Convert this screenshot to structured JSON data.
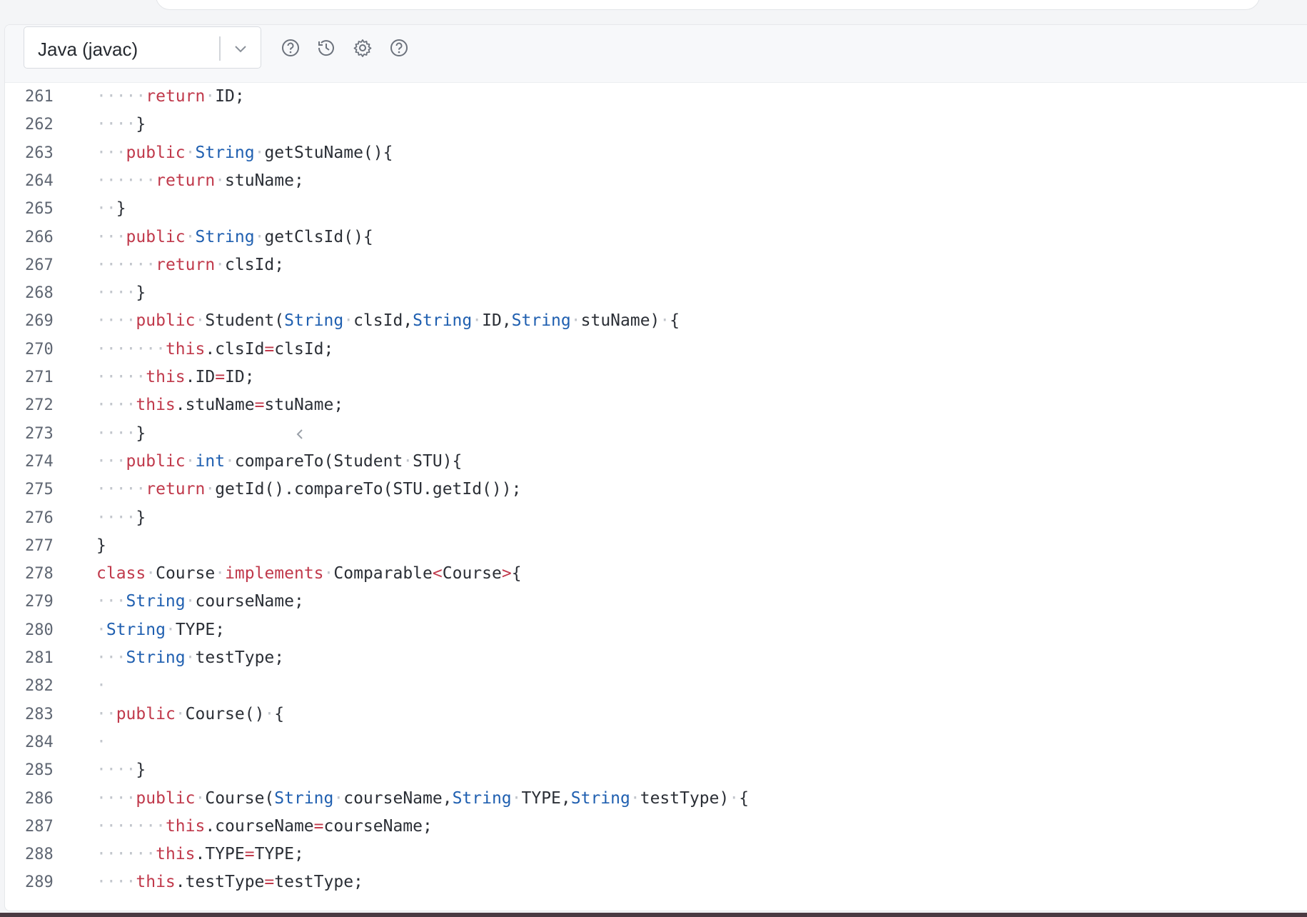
{
  "toolbar": {
    "language": "Java (javac)",
    "icons": [
      "help-circle-icon",
      "history-icon",
      "gear-icon",
      "help-circle-icon"
    ]
  },
  "colors": {
    "keyword": "#c0394b",
    "type": "#1f5fb0",
    "whitespace_dot": "#c2c6cc",
    "line_number": "#5f6672"
  },
  "editor": {
    "lines": [
      {
        "n": "261",
        "tokens": [
          [
            "ws",
            "·····"
          ],
          [
            "kw",
            "return"
          ],
          [
            "ws",
            "·"
          ],
          [
            "tx",
            "ID;"
          ]
        ]
      },
      {
        "n": "262",
        "tokens": [
          [
            "ws",
            "····"
          ],
          [
            "tx",
            "}"
          ]
        ]
      },
      {
        "n": "263",
        "tokens": [
          [
            "ws",
            "···"
          ],
          [
            "kw",
            "public"
          ],
          [
            "ws",
            "·"
          ],
          [
            "ty",
            "String"
          ],
          [
            "ws",
            "·"
          ],
          [
            "tx",
            "getStuName(){"
          ]
        ]
      },
      {
        "n": "264",
        "tokens": [
          [
            "ws",
            "······"
          ],
          [
            "kw",
            "return"
          ],
          [
            "ws",
            "·"
          ],
          [
            "tx",
            "stuName;"
          ]
        ]
      },
      {
        "n": "265",
        "tokens": [
          [
            "ws",
            "··"
          ],
          [
            "tx",
            "}"
          ]
        ]
      },
      {
        "n": "266",
        "tokens": [
          [
            "ws",
            "···"
          ],
          [
            "kw",
            "public"
          ],
          [
            "ws",
            "·"
          ],
          [
            "ty",
            "String"
          ],
          [
            "ws",
            "·"
          ],
          [
            "tx",
            "getClsId(){"
          ]
        ]
      },
      {
        "n": "267",
        "tokens": [
          [
            "ws",
            "······"
          ],
          [
            "kw",
            "return"
          ],
          [
            "ws",
            "·"
          ],
          [
            "tx",
            "clsId;"
          ]
        ]
      },
      {
        "n": "268",
        "tokens": [
          [
            "ws",
            "····"
          ],
          [
            "tx",
            "}"
          ]
        ]
      },
      {
        "n": "269",
        "tokens": [
          [
            "ws",
            "····"
          ],
          [
            "kw",
            "public"
          ],
          [
            "ws",
            "·"
          ],
          [
            "tx",
            "Student("
          ],
          [
            "ty",
            "String"
          ],
          [
            "ws",
            "·"
          ],
          [
            "tx",
            "clsId,"
          ],
          [
            "ty",
            "String"
          ],
          [
            "ws",
            "·"
          ],
          [
            "tx",
            "ID,"
          ],
          [
            "ty",
            "String"
          ],
          [
            "ws",
            "·"
          ],
          [
            "tx",
            "stuName)"
          ],
          [
            "ws",
            "·"
          ],
          [
            "tx",
            "{"
          ]
        ]
      },
      {
        "n": "270",
        "tokens": [
          [
            "ws",
            "·······"
          ],
          [
            "kw",
            "this"
          ],
          [
            "tx",
            ".clsId"
          ],
          [
            "op",
            "="
          ],
          [
            "tx",
            "clsId;"
          ]
        ]
      },
      {
        "n": "271",
        "tokens": [
          [
            "ws",
            "·····"
          ],
          [
            "kw",
            "this"
          ],
          [
            "tx",
            ".ID"
          ],
          [
            "op",
            "="
          ],
          [
            "tx",
            "ID;"
          ]
        ]
      },
      {
        "n": "272",
        "tokens": [
          [
            "ws",
            "····"
          ],
          [
            "kw",
            "this"
          ],
          [
            "tx",
            ".stuName"
          ],
          [
            "op",
            "="
          ],
          [
            "tx",
            "stuName;"
          ]
        ]
      },
      {
        "n": "273",
        "tokens": [
          [
            "ws",
            "····"
          ],
          [
            "tx",
            "}"
          ]
        ]
      },
      {
        "n": "274",
        "tokens": [
          [
            "ws",
            "···"
          ],
          [
            "kw",
            "public"
          ],
          [
            "ws",
            "·"
          ],
          [
            "ty",
            "int"
          ],
          [
            "ws",
            "·"
          ],
          [
            "tx",
            "compareTo(Student"
          ],
          [
            "ws",
            "·"
          ],
          [
            "tx",
            "STU){"
          ]
        ]
      },
      {
        "n": "275",
        "tokens": [
          [
            "ws",
            "·····"
          ],
          [
            "kw",
            "return"
          ],
          [
            "ws",
            "·"
          ],
          [
            "tx",
            "getId().compareTo(STU.getId());"
          ]
        ]
      },
      {
        "n": "276",
        "tokens": [
          [
            "ws",
            "····"
          ],
          [
            "tx",
            "}"
          ]
        ]
      },
      {
        "n": "277",
        "tokens": [
          [
            "tx",
            "}"
          ]
        ]
      },
      {
        "n": "278",
        "tokens": [
          [
            "kw",
            "class"
          ],
          [
            "ws",
            "·"
          ],
          [
            "tx",
            "Course"
          ],
          [
            "ws",
            "·"
          ],
          [
            "kw",
            "implements"
          ],
          [
            "ws",
            "·"
          ],
          [
            "tx",
            "Comparable"
          ],
          [
            "op",
            "<"
          ],
          [
            "tx",
            "Course"
          ],
          [
            "op",
            ">"
          ],
          [
            "tx",
            "{"
          ]
        ]
      },
      {
        "n": "279",
        "tokens": [
          [
            "ws",
            "···"
          ],
          [
            "ty",
            "String"
          ],
          [
            "ws",
            "·"
          ],
          [
            "tx",
            "courseName;"
          ]
        ]
      },
      {
        "n": "280",
        "tokens": [
          [
            "ws",
            "·"
          ],
          [
            "ty",
            "String"
          ],
          [
            "ws",
            "·"
          ],
          [
            "tx",
            "TYPE;"
          ]
        ]
      },
      {
        "n": "281",
        "tokens": [
          [
            "ws",
            "···"
          ],
          [
            "ty",
            "String"
          ],
          [
            "ws",
            "·"
          ],
          [
            "tx",
            "testType;"
          ]
        ]
      },
      {
        "n": "282",
        "tokens": [
          [
            "ws",
            "·"
          ]
        ]
      },
      {
        "n": "283",
        "tokens": [
          [
            "ws",
            "··"
          ],
          [
            "kw",
            "public"
          ],
          [
            "ws",
            "·"
          ],
          [
            "tx",
            "Course()"
          ],
          [
            "ws",
            "·"
          ],
          [
            "tx",
            "{"
          ]
        ]
      },
      {
        "n": "284",
        "tokens": [
          [
            "ws",
            "·"
          ]
        ]
      },
      {
        "n": "285",
        "tokens": [
          [
            "ws",
            "····"
          ],
          [
            "tx",
            "}"
          ]
        ]
      },
      {
        "n": "286",
        "tokens": [
          [
            "ws",
            "····"
          ],
          [
            "kw",
            "public"
          ],
          [
            "ws",
            "·"
          ],
          [
            "tx",
            "Course("
          ],
          [
            "ty",
            "String"
          ],
          [
            "ws",
            "·"
          ],
          [
            "tx",
            "courseName,"
          ],
          [
            "ty",
            "String"
          ],
          [
            "ws",
            "·"
          ],
          [
            "tx",
            "TYPE,"
          ],
          [
            "ty",
            "String"
          ],
          [
            "ws",
            "·"
          ],
          [
            "tx",
            "testType)"
          ],
          [
            "ws",
            "·"
          ],
          [
            "tx",
            "{"
          ]
        ]
      },
      {
        "n": "287",
        "tokens": [
          [
            "ws",
            "·······"
          ],
          [
            "kw",
            "this"
          ],
          [
            "tx",
            ".courseName"
          ],
          [
            "op",
            "="
          ],
          [
            "tx",
            "courseName;"
          ]
        ]
      },
      {
        "n": "288",
        "tokens": [
          [
            "ws",
            "······"
          ],
          [
            "kw",
            "this"
          ],
          [
            "tx",
            ".TYPE"
          ],
          [
            "op",
            "="
          ],
          [
            "tx",
            "TYPE;"
          ]
        ]
      },
      {
        "n": "289",
        "tokens": [
          [
            "ws",
            "····"
          ],
          [
            "kw",
            "this"
          ],
          [
            "tx",
            ".testType"
          ],
          [
            "op",
            "="
          ],
          [
            "tx",
            "testType;"
          ]
        ]
      }
    ]
  }
}
